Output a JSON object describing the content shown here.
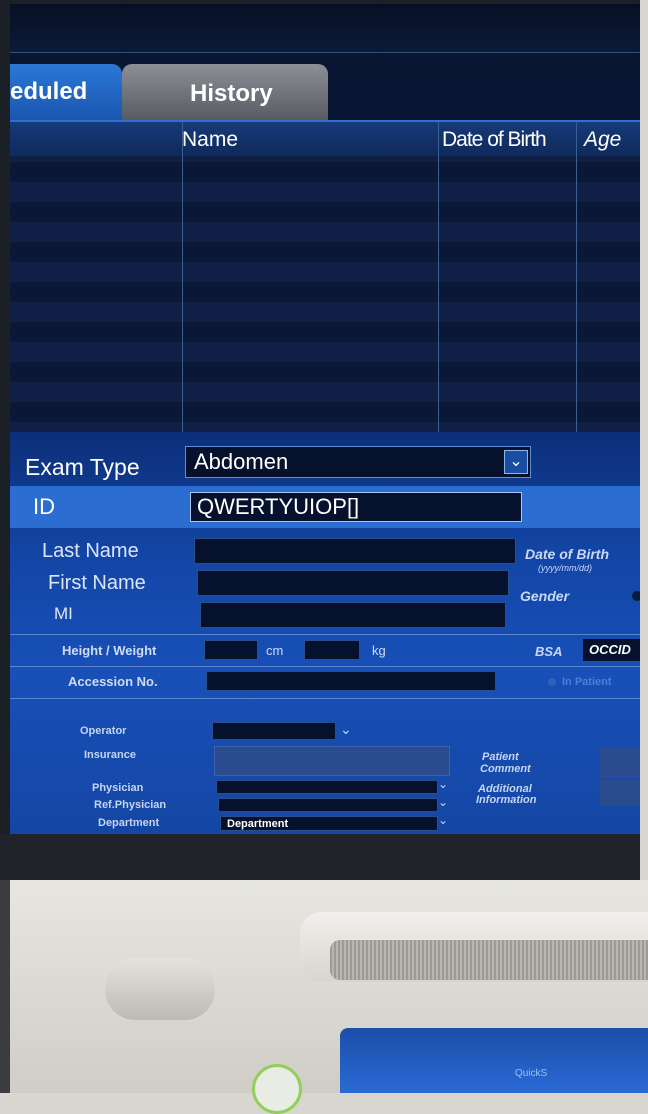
{
  "tabs": [
    {
      "label": "eduled",
      "active": true
    },
    {
      "label": "History",
      "active": false
    }
  ],
  "worklist": {
    "columns": [
      "Name",
      "Date of Birth",
      "Age"
    ]
  },
  "form": {
    "exam_type": {
      "label": "Exam Type",
      "value": "Abdomen"
    },
    "id": {
      "label": "ID",
      "value": "QWERTYUIOP[]"
    },
    "last_name": {
      "label": "Last Name",
      "value": ""
    },
    "first_name": {
      "label": "First Name",
      "value": ""
    },
    "mi": {
      "label": "MI",
      "value": ""
    },
    "date_of_birth": {
      "label": "Date of Birth",
      "format": "(yyyy/mm/dd)"
    },
    "gender": {
      "label": "Gender"
    },
    "height_weight": {
      "label": "Height / Weight",
      "height_unit": "cm",
      "weight_unit": "kg"
    },
    "bsa": {
      "label": "BSA",
      "value": "OCCID"
    },
    "accession": {
      "label": "Accession No.",
      "value": ""
    },
    "in_patient": {
      "label": "In Patient"
    },
    "operator": {
      "label": "Operator",
      "value": ""
    },
    "insurance": {
      "label": "Insurance",
      "value": ""
    },
    "patient_comment": {
      "label_line1": "Patient",
      "label_line2": "Comment"
    },
    "physician": {
      "label": "Physician",
      "value": ""
    },
    "ref_physician": {
      "label": "Ref.Physician",
      "value": ""
    },
    "additional_info": {
      "label_line1": "Additional",
      "label_line2": "Information"
    },
    "department": {
      "label": "Department",
      "value": "Department"
    }
  },
  "console": {
    "quick_label": "QuickS"
  },
  "colors": {
    "tab_active": "#2a78d6",
    "tab_inactive": "#6e7178",
    "form_blue": "#1850b8",
    "id_row": "#2b6dd0"
  }
}
